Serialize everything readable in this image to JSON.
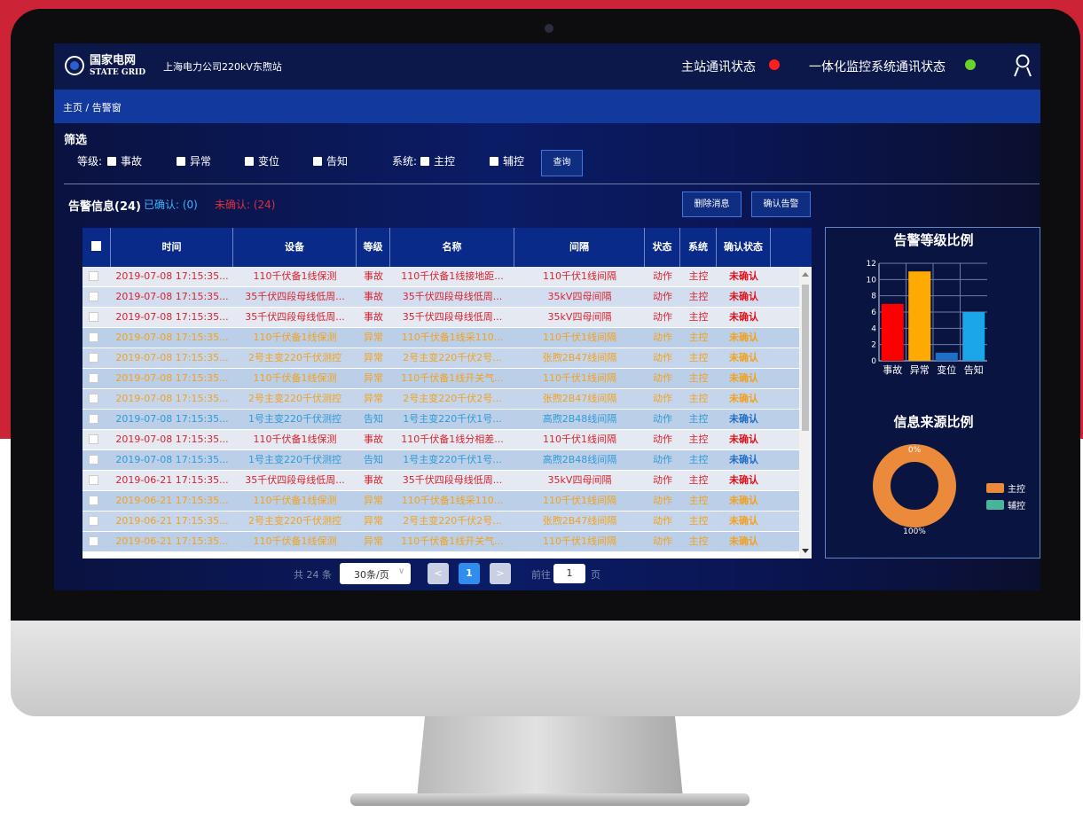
{
  "header": {
    "brand_cn": "国家电网",
    "brand_en": "STATE GRID",
    "station": "上海电力公司220kV东煦站",
    "status_main": "主站通讯状态",
    "status_main_color": "#ff1e1e",
    "status_monitor": "一体化监控系统通讯状态",
    "status_monitor_color": "#6cd12a"
  },
  "breadcrumb": "主页 / 告警窗",
  "filter": {
    "title": "筛选",
    "level_label": "等级:",
    "levels": [
      "事故",
      "异常",
      "变位",
      "告知"
    ],
    "system_label": "系统:",
    "systems": [
      "主控",
      "辅控"
    ],
    "query_button": "查询"
  },
  "alarm": {
    "title": "告警信息(24)",
    "confirmed": "已确认: (0)",
    "unconfirmed": "未确认: (24)",
    "delete_button": "删除消息",
    "confirm_button": "确认告警"
  },
  "table": {
    "columns": [
      "时间",
      "设备",
      "等级",
      "名称",
      "间隔",
      "状态",
      "系统",
      "确认状态"
    ],
    "rows": [
      {
        "time": "2019-07-08 17:15:35...",
        "device": "110千伏备1线保测",
        "level": "事故",
        "name": "110千伏备1线接地距...",
        "bay": "110千伏1线间隔",
        "state": "动作",
        "system": "主控",
        "ack": "未确认",
        "kind": "accident"
      },
      {
        "time": "2019-07-08 17:15:35...",
        "device": "35千伏四段母线低周...",
        "level": "事故",
        "name": "35千伏四段母线低周...",
        "bay": "35kV四母间隔",
        "state": "动作",
        "system": "主控",
        "ack": "未确认",
        "kind": "accident"
      },
      {
        "time": "2019-07-08 17:15:35...",
        "device": "35千伏四段母线低周...",
        "level": "事故",
        "name": "35千伏四段母线低周...",
        "bay": "35kV四母间隔",
        "state": "动作",
        "system": "主控",
        "ack": "未确认",
        "kind": "accident"
      },
      {
        "time": "2019-07-08 17:15:35...",
        "device": "110千伏备1线保测",
        "level": "异常",
        "name": "110千伏备1线采110...",
        "bay": "110千伏1线间隔",
        "state": "动作",
        "system": "主控",
        "ack": "未确认",
        "kind": "abnormal"
      },
      {
        "time": "2019-07-08 17:15:35...",
        "device": "2号主变220千伏测控",
        "level": "异常",
        "name": "2号主变220千伏2号...",
        "bay": "张煦2B47线间隔",
        "state": "动作",
        "system": "主控",
        "ack": "未确认",
        "kind": "abnormal"
      },
      {
        "time": "2019-07-08 17:15:35...",
        "device": "110千伏备1线保测",
        "level": "异常",
        "name": "110千伏备1线开关气...",
        "bay": "110千伏1线间隔",
        "state": "动作",
        "system": "主控",
        "ack": "未确认",
        "kind": "abnormal"
      },
      {
        "time": "2019-07-08 17:15:35...",
        "device": "2号主变220千伏测控",
        "level": "异常",
        "name": "2号主变220千伏2号...",
        "bay": "张煦2B47线间隔",
        "state": "动作",
        "system": "主控",
        "ack": "未确认",
        "kind": "abnormal"
      },
      {
        "time": "2019-07-08 17:15:35...",
        "device": "1号主变220千伏测控",
        "level": "告知",
        "name": "1号主变220千伏1号...",
        "bay": "高煦2B48线间隔",
        "state": "动作",
        "system": "主控",
        "ack": "未确认",
        "kind": "notice"
      },
      {
        "time": "2019-07-08 17:15:35...",
        "device": "110千伏备1线保测",
        "level": "事故",
        "name": "110千伏备1线分相差...",
        "bay": "110千伏1线间隔",
        "state": "动作",
        "system": "主控",
        "ack": "未确认",
        "kind": "accident"
      },
      {
        "time": "2019-07-08 17:15:35...",
        "device": "1号主变220千伏测控",
        "level": "告知",
        "name": "1号主变220千伏1号...",
        "bay": "高煦2B48线间隔",
        "state": "动作",
        "system": "主控",
        "ack": "未确认",
        "kind": "notice"
      },
      {
        "time": "2019-06-21 17:15:35...",
        "device": "35千伏四段母线低周...",
        "level": "事故",
        "name": "35千伏四段母线低周...",
        "bay": "35kV四母间隔",
        "state": "动作",
        "system": "主控",
        "ack": "未确认",
        "kind": "accident"
      },
      {
        "time": "2019-06-21 17:15:35...",
        "device": "110千伏备1线保测",
        "level": "异常",
        "name": "110千伏备1线采110...",
        "bay": "110千伏1线间隔",
        "state": "动作",
        "system": "主控",
        "ack": "未确认",
        "kind": "abnormal"
      },
      {
        "time": "2019-06-21 17:15:35...",
        "device": "2号主变220千伏测控",
        "level": "异常",
        "name": "2号主变220千伏2号...",
        "bay": "张煦2B47线间隔",
        "state": "动作",
        "system": "主控",
        "ack": "未确认",
        "kind": "abnormal"
      },
      {
        "time": "2019-06-21 17:15:35...",
        "device": "110千伏备1线保测",
        "level": "异常",
        "name": "110千伏备1线开关气...",
        "bay": "110千伏1线间隔",
        "state": "动作",
        "system": "主控",
        "ack": "未确认",
        "kind": "abnormal"
      }
    ],
    "colors": {
      "accident": "#d9232e",
      "abnormal": "#f2a21d",
      "notice": "#2f9bd6",
      "ack_accident": "#e0141e",
      "ack_abnormal": "#f2a21d",
      "ack_notice": "#1f6fc5"
    }
  },
  "pagination": {
    "total": "共 24 条",
    "page_size": "30条/页",
    "current": "1",
    "goto_label": "前往",
    "goto_value": "1",
    "unit": "页"
  },
  "chart_data": [
    {
      "type": "bar",
      "title": "告警等级比例",
      "categories": [
        "事故",
        "异常",
        "变位",
        "告知"
      ],
      "values": [
        7,
        11,
        1,
        6
      ],
      "colors": [
        "#ff0000",
        "#ffaa00",
        "#1f6fc5",
        "#1aa6e8"
      ],
      "ylim": [
        0,
        12
      ],
      "ticks": [
        0,
        2,
        4,
        6,
        8,
        10,
        12
      ],
      "grid": true
    },
    {
      "type": "pie",
      "title": "信息来源比例",
      "labels": [
        "主控",
        "辅控"
      ],
      "values": [
        100,
        0
      ],
      "value_labels": [
        "100%",
        "0%"
      ],
      "colors": [
        "#ea8a3a",
        "#48b59a"
      ]
    }
  ]
}
